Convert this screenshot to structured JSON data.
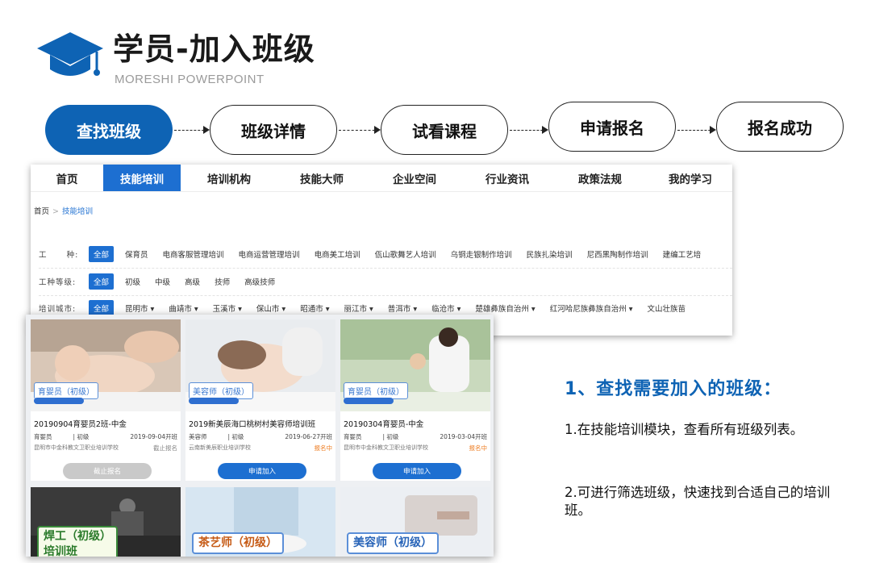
{
  "slide": {
    "title": "学员-加入班级",
    "subtitle": "MORESHI POWERPOINT"
  },
  "steps": [
    {
      "label": "查找班级",
      "active": true
    },
    {
      "label": "班级详情",
      "active": false
    },
    {
      "label": "试看课程",
      "active": false
    },
    {
      "label": "申请报名",
      "active": false
    },
    {
      "label": "报名成功",
      "active": false
    }
  ],
  "site": {
    "nav": [
      "首页",
      "技能培训",
      "培训机构",
      "技能大师",
      "企业空间",
      "行业资讯",
      "政策法规",
      "我的学习"
    ],
    "nav_active": "技能培训",
    "breadcrumb": {
      "home": "首页",
      "sep": ">",
      "current": "技能培训"
    },
    "filters": [
      {
        "label": "工      种:",
        "chip": "全部",
        "options": [
          "保育员",
          "电商客服管理培训",
          "电商运营管理培训",
          "电商美工培训",
          "佤山歌舞艺人培训",
          "乌铜走银制作培训",
          "民族扎染培训",
          "尼西黑陶制作培训",
          "建编工艺培"
        ]
      },
      {
        "label": "工种等级:",
        "chip": "全部",
        "options": [
          "初级",
          "中级",
          "高级",
          "技师",
          "高级技师"
        ]
      },
      {
        "label": "培训城市:",
        "chip": "全部",
        "options": [
          "昆明市 ▾",
          "曲靖市 ▾",
          "玉溪市 ▾",
          "保山市 ▾",
          "昭通市 ▾",
          "丽江市 ▾",
          "普洱市 ▾",
          "临沧市 ▾",
          "楚雄彝族自治州 ▾",
          "红河哈尼族彝族自治州 ▾",
          "文山壮族苗"
        ]
      }
    ]
  },
  "cards": [
    {
      "tag": "育婴员（初级）",
      "name": "20190904育婴员2班-中金",
      "type": "育婴员",
      "level": "| 初级",
      "date": "2019-09-04开班",
      "org": "昆明市中金科教文卫职业培训学校",
      "status": "截止报名",
      "button": "截止报名"
    },
    {
      "tag": "美容师（初级）",
      "name": "2019新美辰海口桃树村美容师培训班",
      "type": "美容师",
      "level": "| 初级",
      "date": "2019-06-27开班",
      "org": "云南新美辰职业培训学校",
      "status": "报名中",
      "button": "申请加入"
    },
    {
      "tag": "育婴员（初级）",
      "name": "20190304育婴员-中金",
      "type": "育婴员",
      "level": "| 初级",
      "date": "2019-03-04开班",
      "org": "昆明市中金科教文卫职业培训学校",
      "status": "报名中",
      "button": "申请加入"
    }
  ],
  "cards_row2": [
    {
      "tag_line1": "焊工（初级）",
      "tag_line2": "培训班"
    },
    {
      "tag_line1": "茶艺师（初级）"
    },
    {
      "tag_line1": "美容师（初级）"
    }
  ],
  "panel": {
    "heading": "1、查找需要加入的班级：",
    "p1": "1.在技能培训模块，查看所有班级列表。",
    "p2": "2.可进行筛选班级，快速找到合适自己的培训班。"
  },
  "colors": {
    "accent": "#0e63b4",
    "site_blue": "#1d6fd1",
    "status_orange": "#ee7d22"
  }
}
